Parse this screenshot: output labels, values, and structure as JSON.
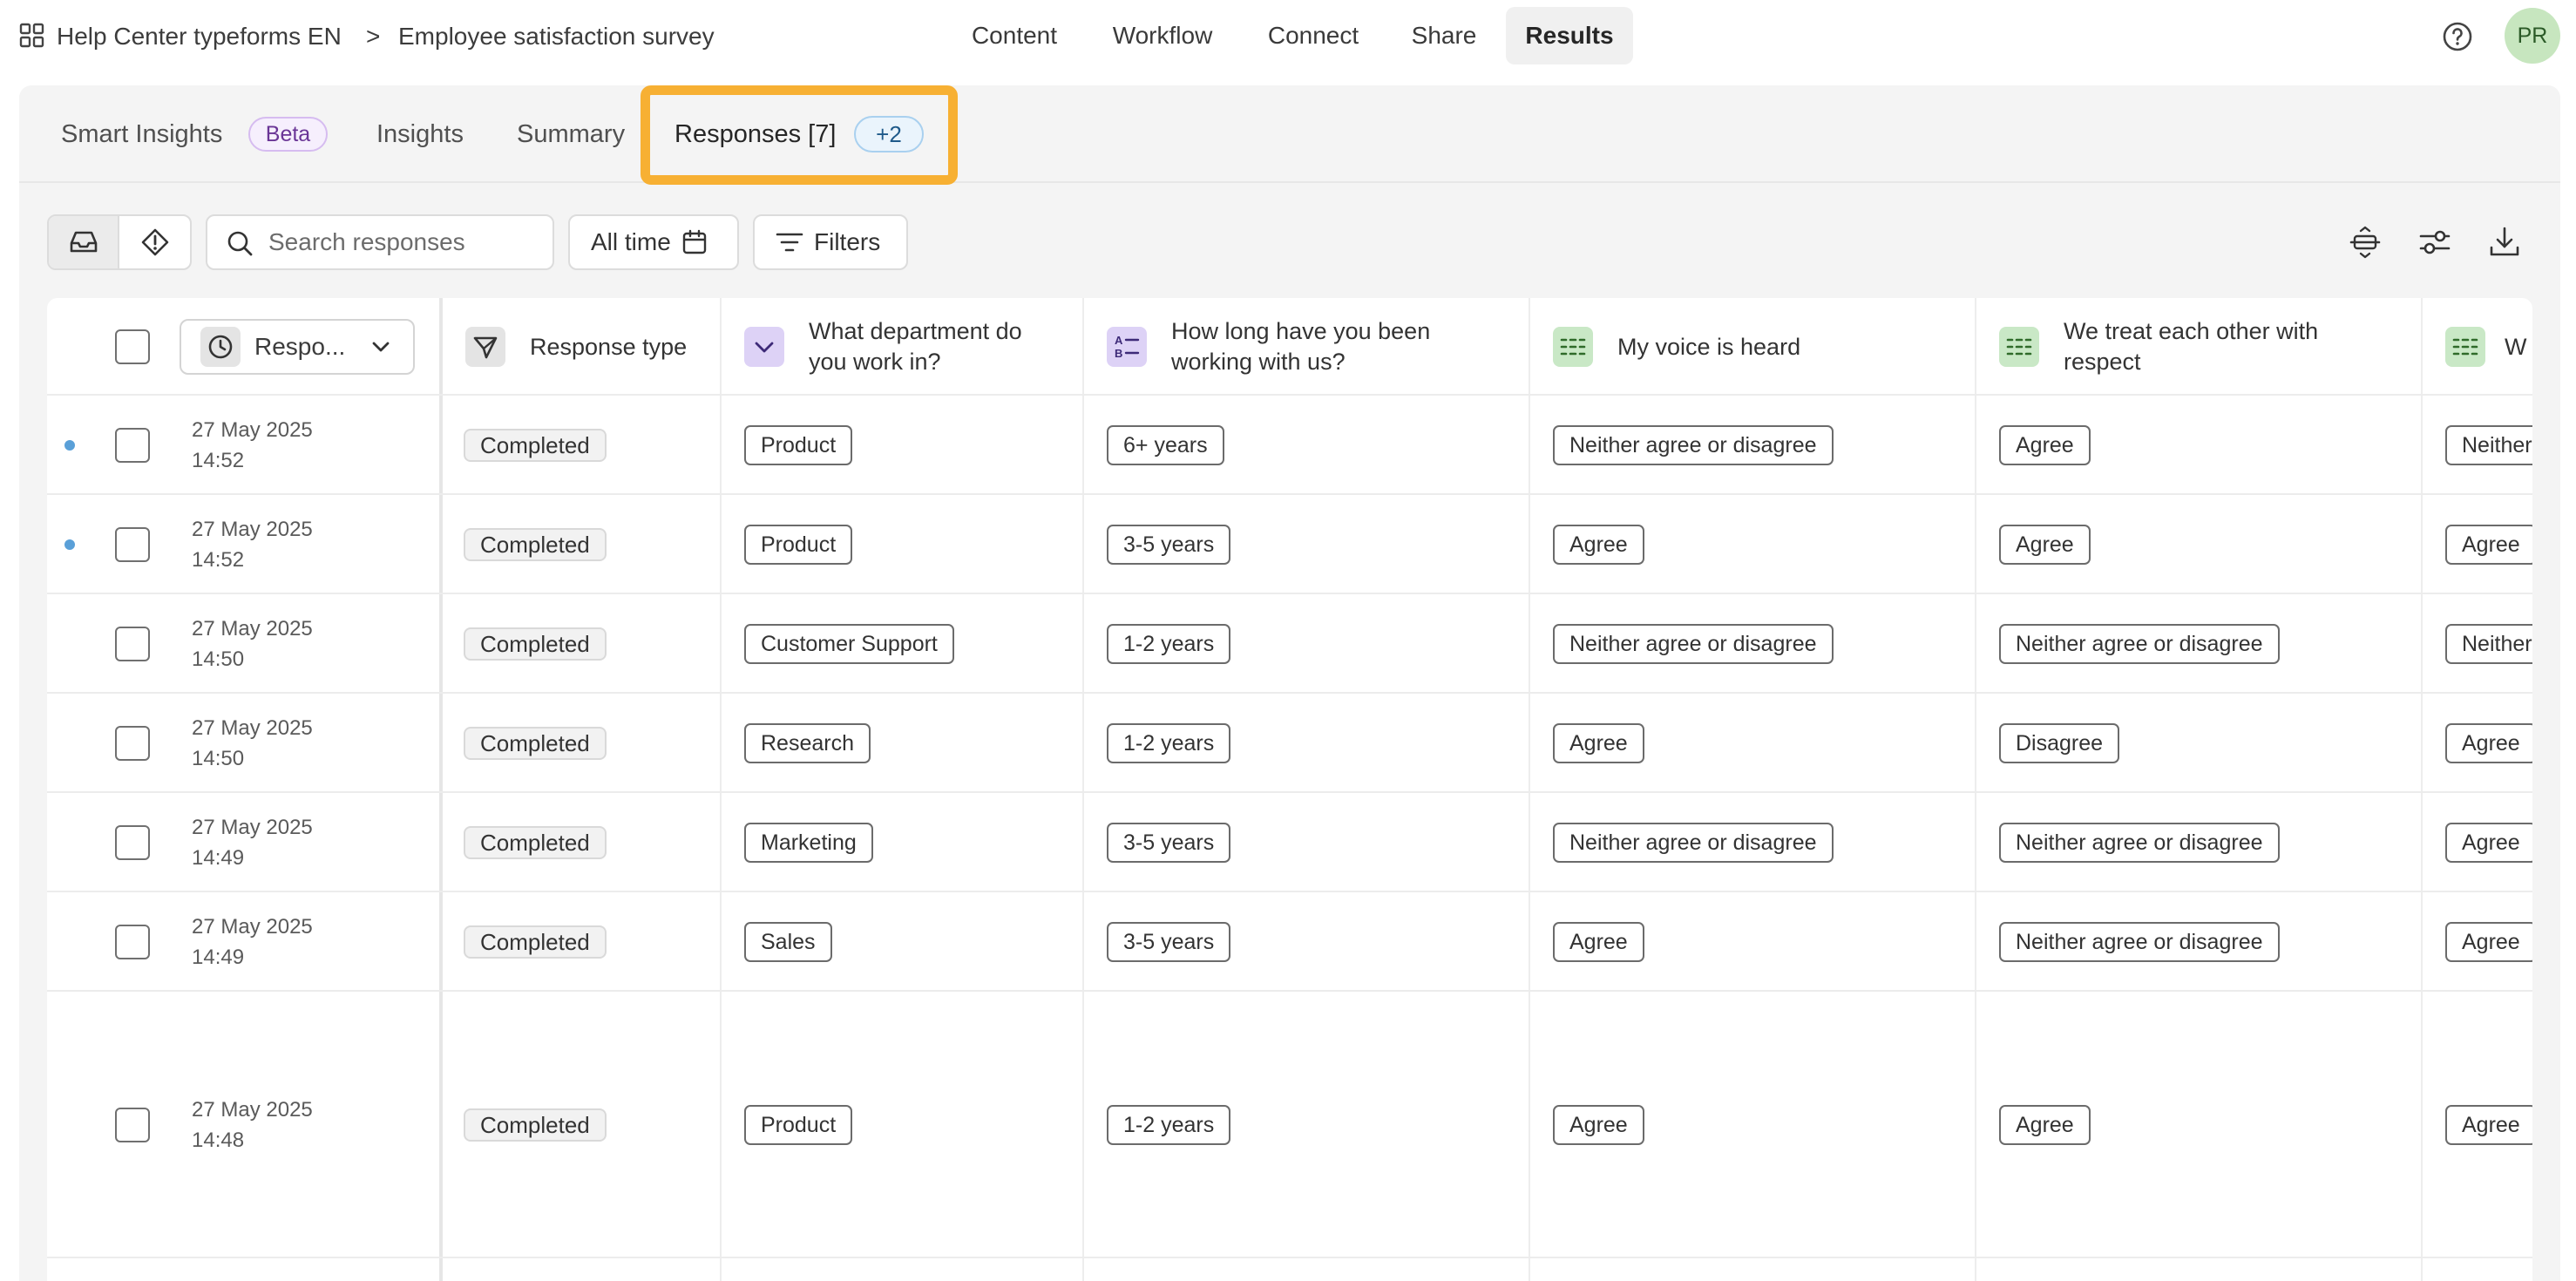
{
  "header": {
    "workspace": "Help Center typeforms EN",
    "separator": ">",
    "form_title": "Employee satisfaction survey",
    "nav": [
      "Content",
      "Workflow",
      "Connect",
      "Share",
      "Results"
    ],
    "active_nav": "Results",
    "avatar_initials": "PR"
  },
  "tabs": {
    "smart_insights": "Smart Insights",
    "beta": "Beta",
    "insights": "Insights",
    "summary": "Summary",
    "responses": "Responses [7]",
    "responses_extra": "+2",
    "highlight_color": "#f7b033"
  },
  "toolbar": {
    "search_placeholder": "Search responses",
    "time_filter": "All time",
    "filters": "Filters"
  },
  "table": {
    "sort_column": "Respo...",
    "columns": [
      "Response type",
      "What department do you work in?",
      "How long have you been working with us?",
      "My voice is heard",
      "We treat each other with respect",
      "W"
    ],
    "rows": [
      {
        "unread": true,
        "date": "27 May 2025",
        "time": "14:52",
        "type": "Completed",
        "department": "Product",
        "tenure": "6+ years",
        "voice": "Neither agree or disagree",
        "respect": "Agree",
        "col6": "Neither"
      },
      {
        "unread": true,
        "date": "27 May 2025",
        "time": "14:52",
        "type": "Completed",
        "department": "Product",
        "tenure": "3-5 years",
        "voice": "Agree",
        "respect": "Agree",
        "col6": "Agree"
      },
      {
        "unread": false,
        "date": "27 May 2025",
        "time": "14:50",
        "type": "Completed",
        "department": "Customer Support",
        "tenure": "1-2 years",
        "voice": "Neither agree or disagree",
        "respect": "Neither agree or disagree",
        "col6": "Neither"
      },
      {
        "unread": false,
        "date": "27 May 2025",
        "time": "14:50",
        "type": "Completed",
        "department": "Research",
        "tenure": "1-2 years",
        "voice": "Agree",
        "respect": "Disagree",
        "col6": "Agree"
      },
      {
        "unread": false,
        "date": "27 May 2025",
        "time": "14:49",
        "type": "Completed",
        "department": "Marketing",
        "tenure": "3-5 years",
        "voice": "Neither agree or disagree",
        "respect": "Neither agree or disagree",
        "col6": "Agree"
      },
      {
        "unread": false,
        "date": "27 May 2025",
        "time": "14:49",
        "type": "Completed",
        "department": "Sales",
        "tenure": "3-5 years",
        "voice": "Agree",
        "respect": "Neither agree or disagree",
        "col6": "Agree"
      },
      {
        "unread": false,
        "date": "27 May 2025",
        "time": "14:48",
        "type": "Completed",
        "department": "Product",
        "tenure": "1-2 years",
        "voice": "Agree",
        "respect": "Agree",
        "col6": "Agree"
      }
    ]
  },
  "colors": {
    "accent_highlight": "#f7b033",
    "unread_dot": "#5aa0d8",
    "avatar_bg": "#c7e6bf",
    "beta_purple": "#6a3596",
    "count_blue": "#1f5a8a"
  }
}
